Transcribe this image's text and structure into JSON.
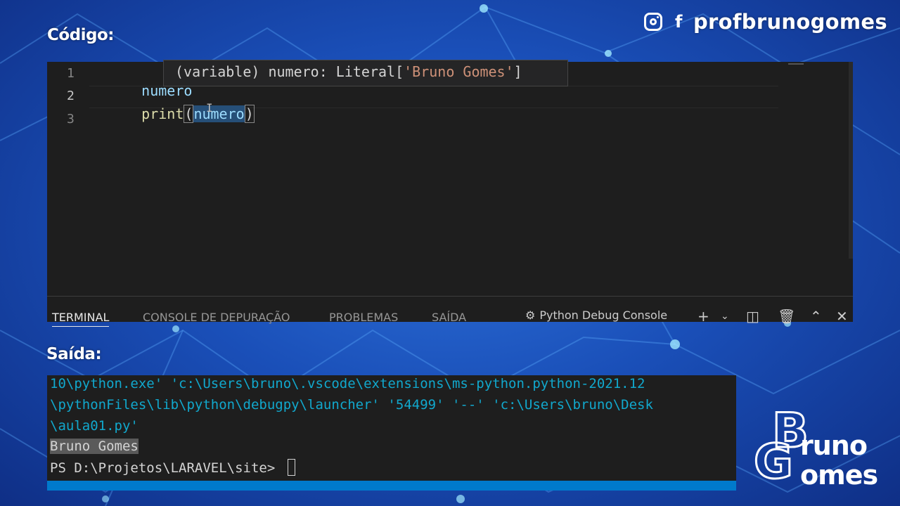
{
  "overlay": {
    "code_label": "Código:",
    "output_label": "Saída:",
    "social_icons": [
      "instagram-icon",
      "facebook-icon"
    ],
    "facebook_glyph": "f",
    "handle": "profbrunogomes",
    "logo": {
      "letter_b": "B",
      "letter_g": "G",
      "word_1": "runo",
      "word_2": "omes"
    }
  },
  "editor": {
    "line_numbers": [
      "1",
      "2",
      "3"
    ],
    "line1_var": "numero",
    "line2_fn": "print",
    "line2_open": "(",
    "line2_arg": "numero",
    "line2_close": ")",
    "hover": {
      "prefix": "(variable) numero: Literal[",
      "string": "'Bruno Gomes'",
      "suffix": "]"
    },
    "colors": {
      "background": "#1e1e1e",
      "variable": "#9cdcfe",
      "function": "#dcdcaa",
      "string": "#ce9178"
    }
  },
  "panel": {
    "tabs": [
      "TERMINAL",
      "CONSOLE DE DEPURAÇÃO",
      "PROBLEMAS",
      "SAÍDA"
    ],
    "active_tab": "TERMINAL",
    "terminal_selector": "Python Debug Console",
    "actions": [
      "plus-icon",
      "chevron-down-icon",
      "split-icon",
      "trash-icon",
      "chevron-up-icon",
      "close-icon"
    ]
  },
  "terminal": {
    "lines": [
      "10\\python.exe' 'c:\\Users\\bruno\\.vscode\\extensions\\ms-python.python-2021.12",
      "\\pythonFiles\\lib\\python\\debugpy\\launcher' '54499' '--' 'c:\\Users\\bruno\\Desk",
      "\\aula01.py'"
    ],
    "output": "Bruno Gomes",
    "prompt": "PS D:\\Projetos\\LARAVEL\\site> "
  }
}
